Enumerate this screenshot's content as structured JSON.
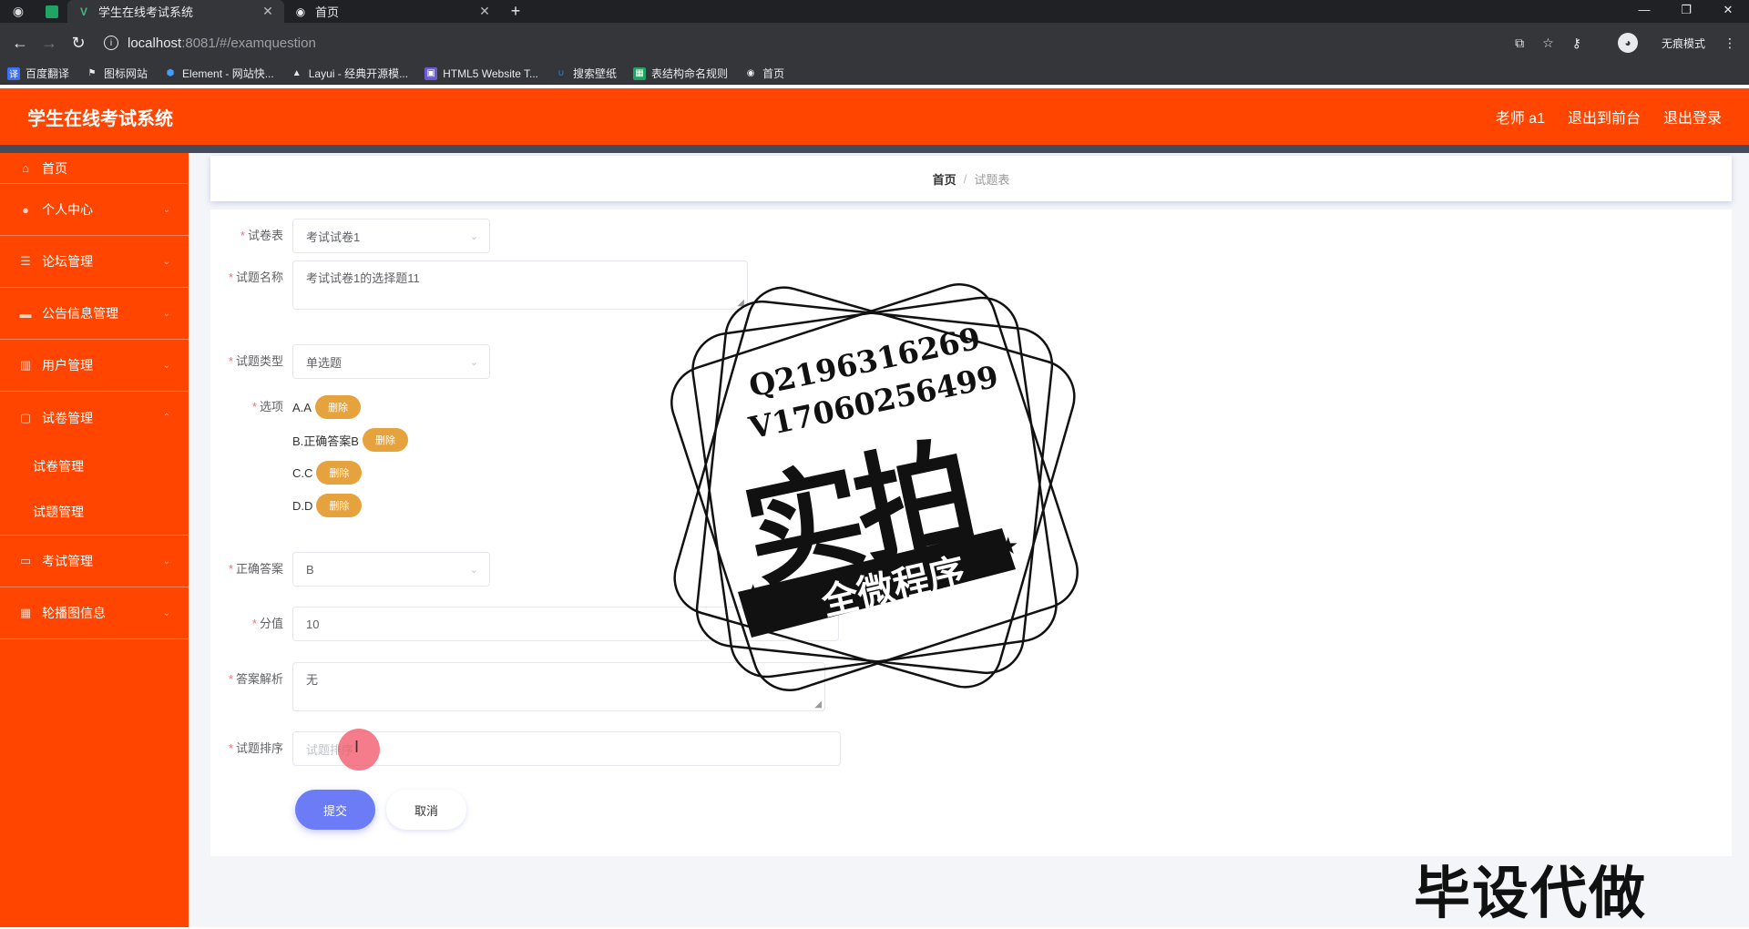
{
  "browser": {
    "tabs": [
      {
        "title": "学生在线考试系统",
        "active": true
      },
      {
        "title": "首页",
        "active": false
      }
    ],
    "url_host": "localhost",
    "url_path": ":8081/#/examquestion",
    "incognito_label": "无痕模式",
    "bookmarks": [
      {
        "label": "百度翻译",
        "color": "#3b6ff5"
      },
      {
        "label": "图标网站",
        "color": "#e8eaed"
      },
      {
        "label": "Element - 网站快...",
        "color": "#409eff"
      },
      {
        "label": "Layui - 经典开源模...",
        "color": "#e8eaed"
      },
      {
        "label": "HTML5 Website T...",
        "color": "#6b5bd6"
      },
      {
        "label": "搜索壁纸",
        "color": "#2f7de1"
      },
      {
        "label": "表结构命名规则",
        "color": "#1fa463"
      },
      {
        "label": "首页",
        "color": "#e8eaed"
      }
    ]
  },
  "header": {
    "title": "学生在线考试系统",
    "user": "老师 a1",
    "back_front": "退出到前台",
    "logout": "退出登录"
  },
  "sidebar": {
    "items": [
      {
        "label": "首页",
        "icon": "home-icon"
      },
      {
        "label": "个人中心",
        "icon": "user-icon"
      },
      {
        "label": "论坛管理",
        "icon": "list-icon"
      },
      {
        "label": "公告信息管理",
        "icon": "message-icon"
      },
      {
        "label": "用户管理",
        "icon": "chart-icon"
      },
      {
        "label": "试卷管理",
        "icon": "doc-icon"
      },
      {
        "label": "考试管理",
        "icon": "doc-icon"
      },
      {
        "label": "轮播图信息",
        "icon": "grid-icon"
      }
    ],
    "subitems": [
      "试卷管理",
      "试题管理"
    ]
  },
  "breadcrumb": {
    "home": "首页",
    "current": "试题表"
  },
  "form": {
    "paper_label": "试卷表",
    "paper_value": "考试试卷1",
    "name_label": "试题名称",
    "name_value": "考试试卷1的选择题11",
    "type_label": "试题类型",
    "type_value": "单选题",
    "options_label": "选项",
    "options": [
      "A.A",
      "B.正确答案B",
      "C.C",
      "D.D"
    ],
    "delete_label": "删除",
    "answer_label": "正确答案",
    "answer_value": "B",
    "score_label": "分值",
    "score_value": "10",
    "analysis_label": "答案解析",
    "analysis_value": "无",
    "sort_label": "试题排序",
    "sort_placeholder": "试题排序",
    "submit": "提交",
    "cancel": "取消"
  },
  "watermark": {
    "qq": "Q2196316269",
    "vx": "V17060256499",
    "big": "实拍",
    "ribbon": "全微程序",
    "bottom": "毕设代做"
  }
}
